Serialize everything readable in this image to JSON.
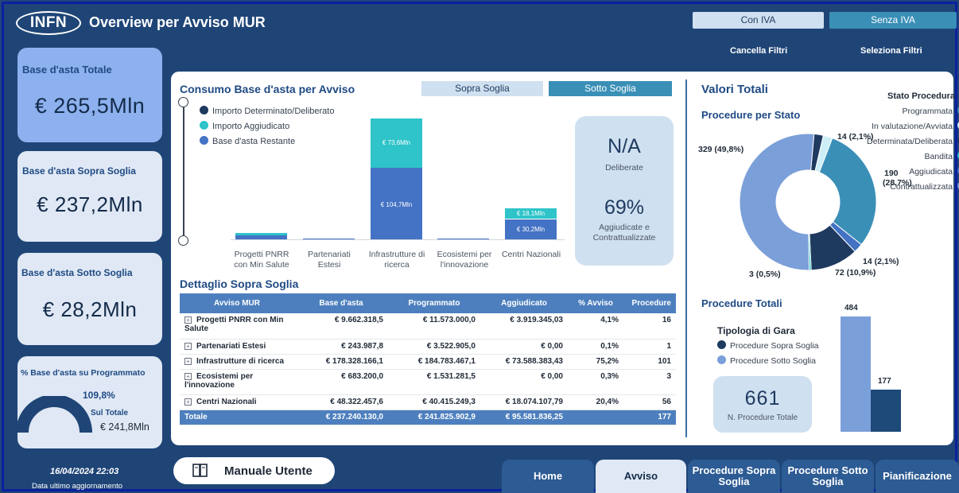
{
  "header": {
    "logo": "INFN",
    "title": "Overview per Avviso MUR",
    "iva_on": "Con IVA",
    "iva_off": "Senza IVA",
    "clear_filters": "Cancella Filtri",
    "select_filters": "Seleziona Filtri"
  },
  "kpis": {
    "totale": {
      "label": "Base d'asta Totale",
      "value": "€ 265,5Mln"
    },
    "sopra": {
      "label": "Base d'asta Sopra Soglia",
      "value": "€ 237,2Mln"
    },
    "sotto": {
      "label": "Base d'asta Sotto Soglia",
      "value": "€ 28,2Mln"
    },
    "programmato": {
      "label": "% Base d'asta su Programmato",
      "pct": "109,8%",
      "sub_label": "Sul Totale",
      "sub_value": "€ 241,8Mln",
      "gauge_fill": 1.0
    }
  },
  "footer": {
    "date": "16/04/2024 22:03",
    "date_label": "Data ultimo aggiornamento",
    "manual": "Manuale Utente"
  },
  "nav": {
    "home": "Home",
    "avviso": "Avviso",
    "sopra": "Procedure Sopra Soglia",
    "sotto": "Procedure Sotto Soglia",
    "pianificazione": "Pianificazione"
  },
  "consumo": {
    "title": "Consumo Base d'asta per Avviso",
    "btn_sopra": "Sopra Soglia",
    "btn_sotto": "Sotto Soglia",
    "legend": [
      {
        "label": "Importo Determinato/Deliberato",
        "color": "#1e3a5f"
      },
      {
        "label": "Importo Aggiudicato",
        "color": "#2ec4c9"
      },
      {
        "label": "Base d'asta Restante",
        "color": "#4472c4"
      }
    ],
    "categories": [
      "Progetti PNRR con Min Salute",
      "Partenariati Estesi",
      "Infrastrutture di ricerca",
      "Ecosistemi per l'innovazione",
      "Centri Nazionali"
    ],
    "labels": {
      "infra_agg": "€ 73,6Mln",
      "infra_rest": "€ 104,7Mln",
      "centri_agg": "€ 18,1Mln",
      "centri_rest": "€ 30,2Mln"
    },
    "card": {
      "na": "N/A",
      "deliberate": "Deliberate",
      "pct": "69%",
      "agg": "Aggiudicate e Contrattualizzate"
    }
  },
  "chart_data": [
    {
      "type": "bar",
      "title": "Consumo Base d'asta per Avviso",
      "categories": [
        "Progetti PNRR con Min Salute",
        "Partenariati Estesi",
        "Infrastrutture di ricerca",
        "Ecosistemi per l'innovazione",
        "Centri Nazionali"
      ],
      "series": [
        {
          "name": "Importo Determinato/Deliberato",
          "values": [
            0,
            0,
            0,
            0,
            0
          ]
        },
        {
          "name": "Importo Aggiudicato",
          "values": [
            3.9,
            0,
            73.6,
            0,
            18.1
          ]
        },
        {
          "name": "Base d'asta Restante",
          "values": [
            5.7,
            0.2,
            104.7,
            0.7,
            30.2
          ]
        }
      ]
    },
    {
      "type": "pie",
      "title": "Procedure per Stato",
      "categories": [
        "Programmata",
        "In valutazione/Avviata",
        "Determinata/Deliberata",
        "Bandita",
        "Aggiudicata",
        "Contrattualizzata"
      ],
      "values": [
        14,
        14,
        3,
        190,
        72,
        329
      ],
      "labels": [
        "14 (2,1%)",
        "14 (2,1%)",
        "3 (0,5%)",
        "190 (28,7%)",
        "72 (10,9%)",
        "329 (49,8%)"
      ]
    },
    {
      "type": "bar",
      "title": "Procedure Totali",
      "categories": [
        "Procedure Sopra Soglia",
        "Procedure Sotto Soglia"
      ],
      "values": [
        177,
        484
      ]
    }
  ],
  "dettaglio": {
    "title": "Dettaglio Sopra Soglia",
    "headers": [
      "Avviso MUR",
      "Base d'asta",
      "Programmato",
      "Aggiudicato",
      "% Avviso",
      "Procedure"
    ],
    "rows": [
      [
        "Progetti PNRR con Min Salute",
        "€ 9.662.318,5",
        "€ 11.573.000,0",
        "€ 3.919.345,03",
        "4,1%",
        "16"
      ],
      [
        "Partenariati Estesi",
        "€ 243.987,8",
        "€ 3.522.905,0",
        "€ 0,00",
        "0,1%",
        "1"
      ],
      [
        "Infrastrutture di ricerca",
        "€ 178.328.166,1",
        "€ 184.783.467,1",
        "€ 73.588.383,43",
        "75,2%",
        "101"
      ],
      [
        "Ecosistemi per l'innovazione",
        "€ 683.200,0",
        "€ 1.531.281,5",
        "€ 0,00",
        "0,3%",
        "3"
      ],
      [
        "Centri Nazionali",
        "€ 48.322.457,6",
        "€ 40.415.249,3",
        "€ 18.074.107,79",
        "20,4%",
        "56"
      ]
    ],
    "total": [
      "Totale",
      "€ 237.240.130,0",
      "€ 241.825.902,9",
      "€ 95.581.836,25",
      "",
      "177"
    ]
  },
  "valori": {
    "title": "Valori Totali",
    "stato_title": "Procedure per Stato",
    "legend_title": "Stato Procedura",
    "stati": [
      {
        "label": "Programmata",
        "color": "#3a8fb7"
      },
      {
        "label": "In valutazione/Avviata",
        "color": "#cdeef7"
      },
      {
        "label": "Determinata/Deliberata",
        "color": "#1e3a5f"
      },
      {
        "label": "Bandita",
        "color": "#2ec4c9"
      },
      {
        "label": "Aggiudicata",
        "color": "#4472c4"
      },
      {
        "label": "Contrattualizzata",
        "color": "#7b9fd9"
      }
    ],
    "pie_labels": {
      "l329": "329 (49,8%)",
      "l14a": "14 (2,1%)",
      "l190a": "190",
      "l190b": "(28,7%)",
      "l14b": "14 (2,1%)",
      "l72": "72 (10,9%)",
      "l3": "3 (0,5%)"
    },
    "totali_title": "Procedure Totali",
    "tipologia_title": "Tipologia di Gara",
    "tipologie": [
      {
        "label": "Procedure Sopra Soglia",
        "color": "#1e3a5f"
      },
      {
        "label": "Procedure Sotto Soglia",
        "color": "#7b9fd9"
      }
    ],
    "total_card": {
      "value": "661",
      "label": "N. Procedure Totale"
    },
    "bar_labels": {
      "sotto": "484",
      "sopra": "177"
    }
  }
}
